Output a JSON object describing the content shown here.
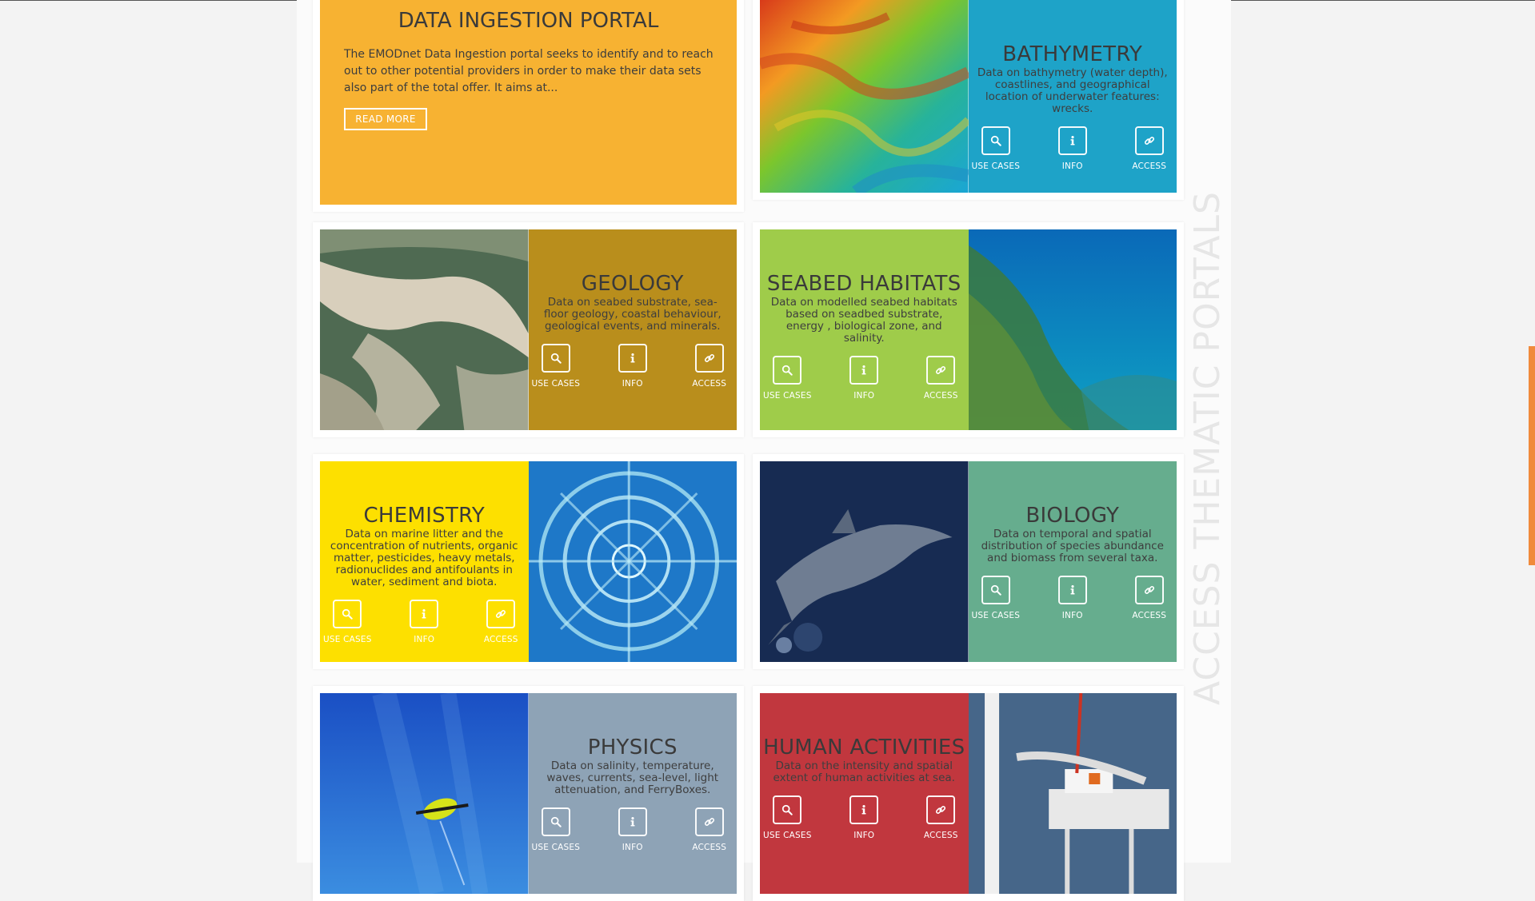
{
  "side_title": "ACCESS THEMATIC PORTALS",
  "ingestion": {
    "title": "DATA INGESTION PORTAL",
    "description": "The EMODnet Data Ingestion portal seeks to identify and to reach out to other potential providers in order to make their data sets also part of the total offer. It aims at...",
    "button": "READ MORE",
    "color": "#f7b232"
  },
  "actions": {
    "use_cases": "USE CASES",
    "info": "INFO",
    "access": "ACCESS"
  },
  "portals": [
    {
      "title": "BATHYMETRY",
      "description": "Data on bathymetry (water depth), coastlines, and geographical location of underwater features: wrecks.",
      "color": "#1ea3c8",
      "photo": "bathymetry-map-image"
    },
    {
      "title": "GEOLOGY",
      "description": "Data on seabed substrate, sea-floor geology, coastal behaviour, geological events, and minerals.",
      "color": "#b98e1c",
      "photo": "geology-coast-aerial-image"
    },
    {
      "title": "SEABED HABITATS",
      "description": "Data on modelled seabed habitats based on seadbed substrate, energy , biological zone, and salinity.",
      "color": "#9fcc4a",
      "photo": "seagrass-underwater-image"
    },
    {
      "title": "CHEMISTRY",
      "description": "Data on marine litter and the concentration of nutrients, organic matter, pesticides, heavy metals, radionuclides and antifoulants in water, sediment and biota.",
      "color": "#fde000",
      "photo": "chemistry-sampler-image"
    },
    {
      "title": "BIOLOGY",
      "description": "Data on temporal and spatial distribution of species abundance and biomass from several taxa.",
      "color": "#66ad8e",
      "photo": "dolphin-image"
    },
    {
      "title": "PHYSICS",
      "description": "Data on salinity, temperature, waves, currents, sea-level, light attenuation, and FerryBoxes.",
      "color": "#8ea3b6",
      "photo": "underwater-glider-image"
    },
    {
      "title": "HUMAN ACTIVITIES",
      "description": "Data on the intensity and spatial extent of human activities at sea.",
      "color": "#c1373e",
      "photo": "wind-turbine-vessel-image"
    }
  ]
}
